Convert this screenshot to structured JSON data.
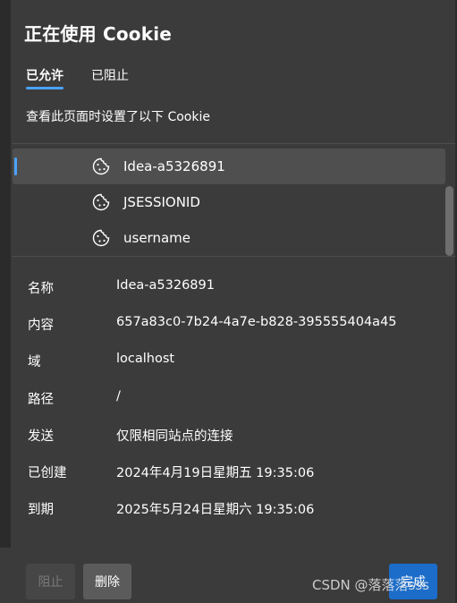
{
  "dialog": {
    "title": "正在使用 Cookie",
    "tabs": [
      {
        "label": "已允许",
        "active": true
      },
      {
        "label": "已阻止",
        "active": false
      }
    ],
    "description": "查看此页面时设置了以下 Cookie"
  },
  "cookies": [
    {
      "name": "Idea-a5326891",
      "icon": "cookie-icon",
      "selected": true
    },
    {
      "name": "JSESSIONID",
      "icon": "cookie-icon",
      "selected": false
    },
    {
      "name": "username",
      "icon": "cookie-icon",
      "selected": false
    }
  ],
  "details": [
    {
      "label": "名称",
      "value": "Idea-a5326891"
    },
    {
      "label": "内容",
      "value": "657a83c0-7b24-4a7e-b828-395555404a45"
    },
    {
      "label": "域",
      "value": "localhost"
    },
    {
      "label": "路径",
      "value": "/"
    },
    {
      "label": "发送",
      "value": "仅限相同站点的连接"
    },
    {
      "label": "已创建",
      "value": "2024年4月19日星期五 19:35:06"
    },
    {
      "label": "到期",
      "value": "2025年5月24日星期六 19:35:06"
    }
  ],
  "buttons": {
    "block": "阻止",
    "delete": "删除",
    "done": "完成"
  },
  "watermark": "CSDN @落落落sss",
  "colors": {
    "background": "#3b3b3b",
    "accent": "#4aa3ff",
    "primary_button": "#1c6dc9",
    "selected_row": "#4f4f4f"
  }
}
